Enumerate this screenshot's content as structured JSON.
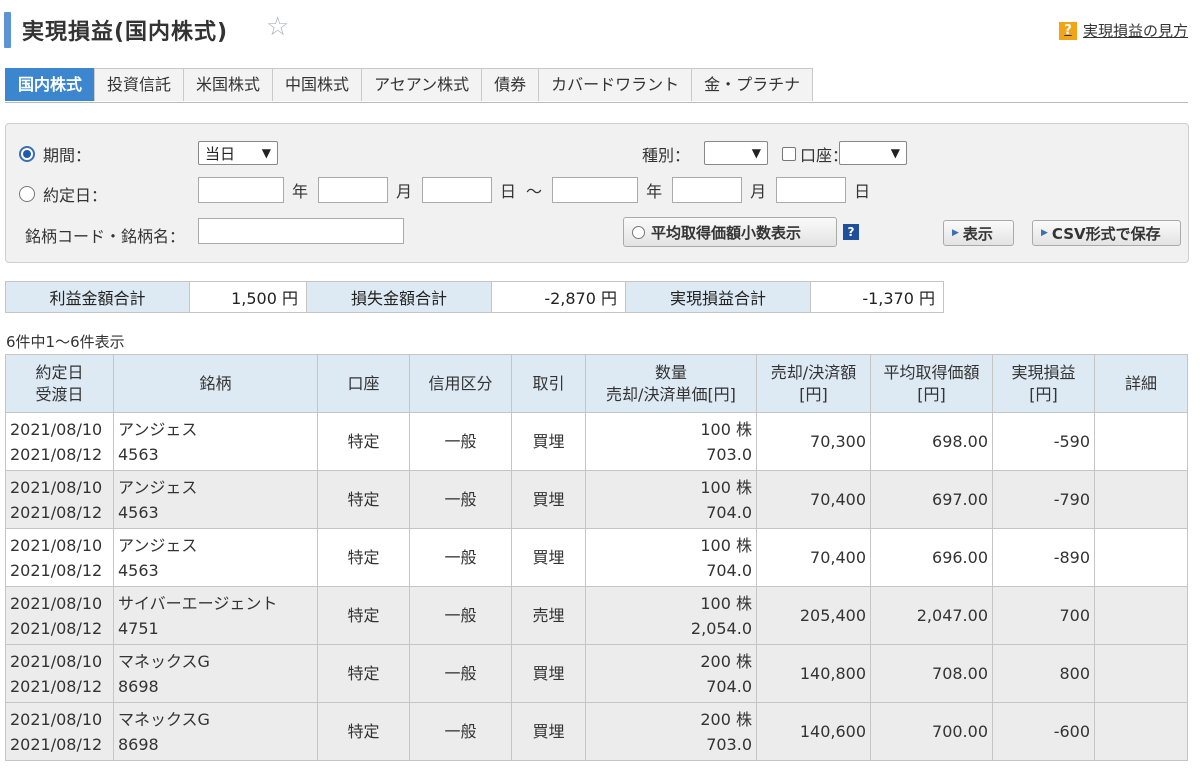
{
  "header": {
    "title": "実現損益(国内株式)",
    "help_link": "実現損益の見方",
    "help_icon_text": "?"
  },
  "tabs": [
    "国内株式",
    "投資信託",
    "米国株式",
    "中国株式",
    "アセアン株式",
    "債券",
    "カバードワラント",
    "金・プラチナ"
  ],
  "filter": {
    "period_label": "期間：",
    "period_value": "当日",
    "contract_date_label": "約定日：",
    "unit_year": "年",
    "unit_month": "月",
    "unit_day": "日",
    "range_sep": "～",
    "type_label": "種別：",
    "account_label": "口座：",
    "code_label": "銘柄コード・銘柄名：",
    "avg_decimal_button": "平均取得価額小数表示",
    "display_button": "表示",
    "csv_button": "CSV形式で保存"
  },
  "summary": {
    "profit_label": "利益金額合計",
    "profit_value": "1,500 円",
    "loss_label": "損失金額合計",
    "loss_value": "-2,870 円",
    "net_label": "実現損益合計",
    "net_value": "-1,370 円"
  },
  "count_text": "6件中1～6件表示",
  "table": {
    "headers": {
      "date1": "約定日",
      "date2": "受渡日",
      "stock": "銘柄",
      "account": "口座",
      "credit": "信用区分",
      "trade": "取引",
      "qty1": "数量",
      "qty2": "売却/決済単価[円]",
      "amount1": "売却/決済額",
      "amount2": "[円]",
      "avg1": "平均取得価額",
      "avg2": "[円]",
      "pl1": "実現損益",
      "pl2": "[円]",
      "detail": "詳細"
    },
    "rows": [
      {
        "contract_date": "2021/08/10",
        "delivery_date": "2021/08/12",
        "name": "アンジェス",
        "code": "4563",
        "account": "特定",
        "credit": "一般",
        "trade": "買埋",
        "quantity": "100 株",
        "unit_price": "703.0",
        "amount": "70,300",
        "avg_price": "698.00",
        "pl": "-590"
      },
      {
        "contract_date": "2021/08/10",
        "delivery_date": "2021/08/12",
        "name": "アンジェス",
        "code": "4563",
        "account": "特定",
        "credit": "一般",
        "trade": "買埋",
        "quantity": "100 株",
        "unit_price": "704.0",
        "amount": "70,400",
        "avg_price": "697.00",
        "pl": "-790"
      },
      {
        "contract_date": "2021/08/10",
        "delivery_date": "2021/08/12",
        "name": "アンジェス",
        "code": "4563",
        "account": "特定",
        "credit": "一般",
        "trade": "買埋",
        "quantity": "100 株",
        "unit_price": "704.0",
        "amount": "70,400",
        "avg_price": "696.00",
        "pl": "-890"
      },
      {
        "contract_date": "2021/08/10",
        "delivery_date": "2021/08/12",
        "name": "サイバーエージェント",
        "code": "4751",
        "account": "特定",
        "credit": "一般",
        "trade": "売埋",
        "quantity": "100 株",
        "unit_price": "2,054.0",
        "amount": "205,400",
        "avg_price": "2,047.00",
        "pl": "700"
      },
      {
        "contract_date": "2021/08/10",
        "delivery_date": "2021/08/12",
        "name": "マネックスG",
        "code": "8698",
        "account": "特定",
        "credit": "一般",
        "trade": "買埋",
        "quantity": "200 株",
        "unit_price": "704.0",
        "amount": "140,800",
        "avg_price": "708.00",
        "pl": "800"
      },
      {
        "contract_date": "2021/08/10",
        "delivery_date": "2021/08/12",
        "name": "マネックスG",
        "code": "8698",
        "account": "特定",
        "credit": "一般",
        "trade": "買埋",
        "quantity": "200 株",
        "unit_price": "703.0",
        "amount": "140,600",
        "avg_price": "700.00",
        "pl": "-600"
      }
    ]
  },
  "colors": {
    "accent": "#3b86cf",
    "header_bg": "#dde9f3",
    "row_alt": "#ececec",
    "help_icon": "#f2a418"
  },
  "icons": {
    "favorite": "star-icon",
    "help": "question-icon",
    "select": "chevron-down-icon"
  }
}
